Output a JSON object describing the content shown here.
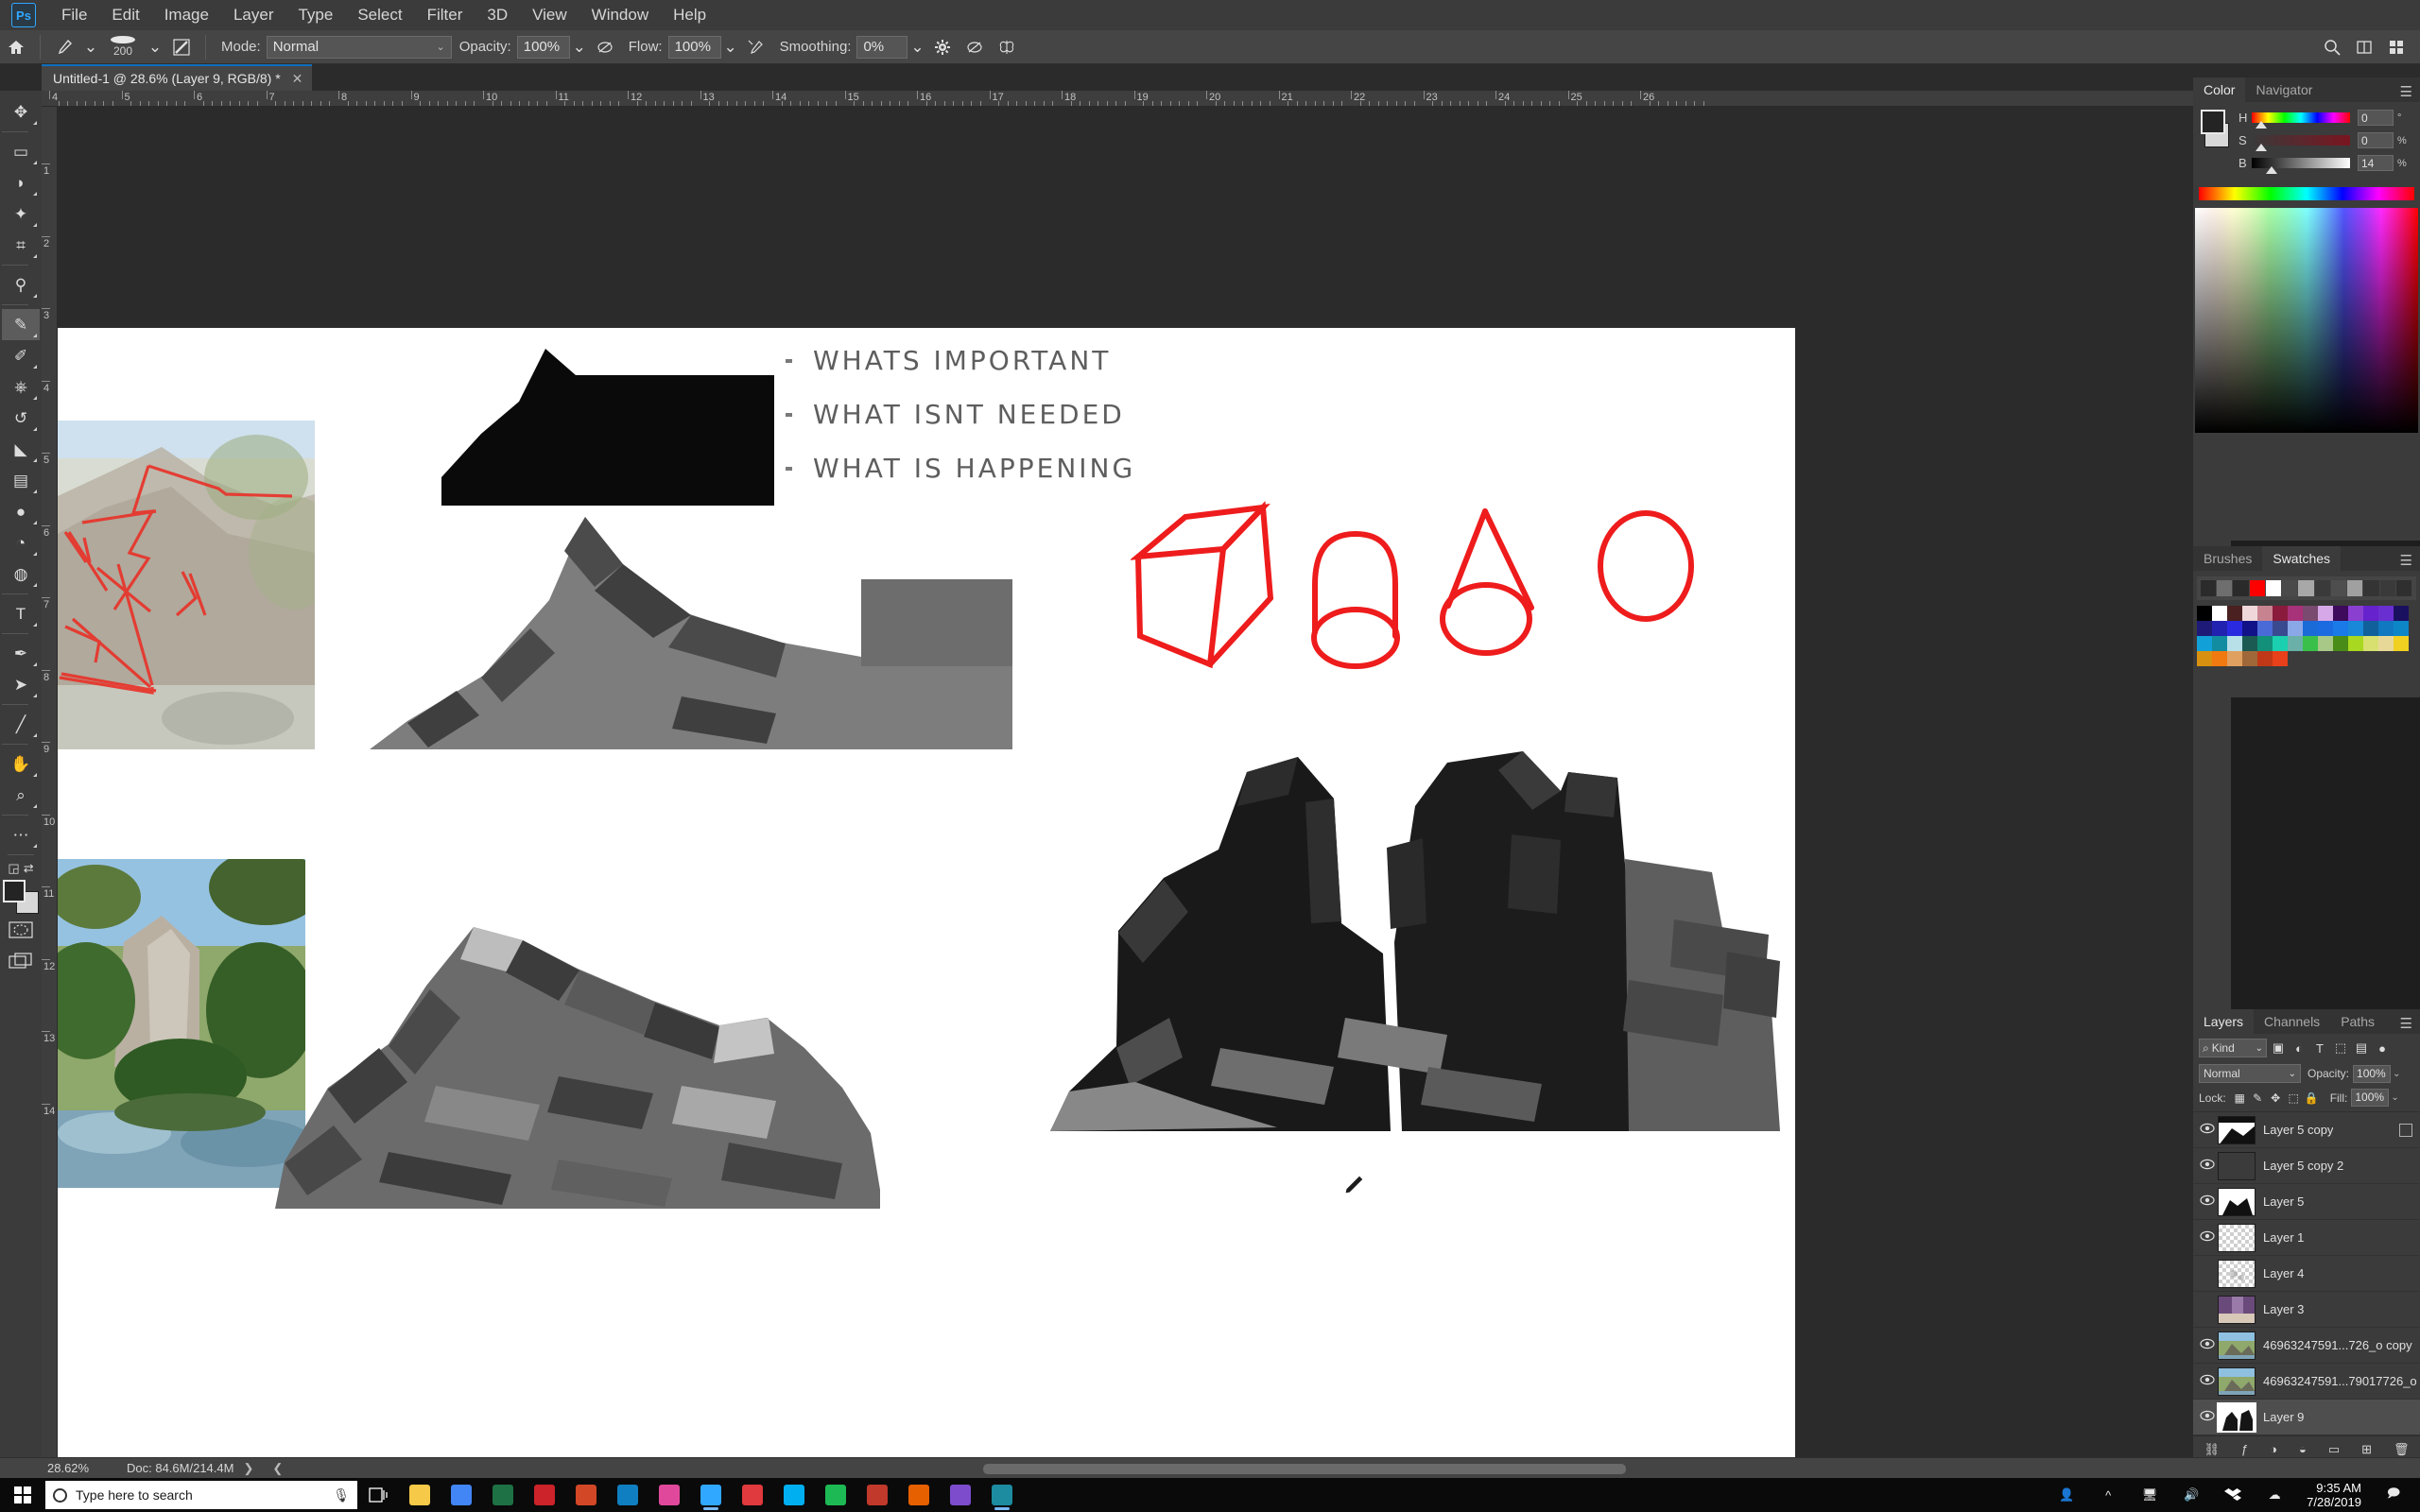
{
  "app": {
    "name": "Adobe Photoshop",
    "logo_text": "Ps"
  },
  "menubar": {
    "items": [
      "File",
      "Edit",
      "Image",
      "Layer",
      "Type",
      "Select",
      "Filter",
      "3D",
      "View",
      "Window",
      "Help"
    ]
  },
  "options_bar": {
    "home_icon": "home-icon",
    "tool_icon": "brush-tool-icon",
    "brush_size": "200",
    "brush_panel_icon": "brush-settings-icon",
    "mode_label": "Mode:",
    "mode_value": "Normal",
    "opacity_label": "Opacity:",
    "opacity_value": "100%",
    "pressure_opacity_icon": "pressure-opacity-icon",
    "flow_label": "Flow:",
    "flow_value": "100%",
    "airbrush_icon": "airbrush-icon",
    "smoothing_label": "Smoothing:",
    "smoothing_value": "0%",
    "smoothing_options_icon": "gear-icon",
    "angle_icon": "brush-angle-icon",
    "symmetry_icon": "symmetry-butterfly-icon",
    "tablet_pressure_icon": "tablet-pressure-icon",
    "search_icon": "search-icon",
    "arrange_icon": "arrange-documents-icon",
    "workspace_icon": "workspace-switcher-icon"
  },
  "document_tab": {
    "title": "Untitled-1 @ 28.6% (Layer 9, RGB/8) *",
    "close_icon": "close-icon"
  },
  "tools": [
    {
      "name": "move-tool",
      "glyph": "✥",
      "selected": false
    },
    {
      "name": "rectangular-marquee-tool",
      "glyph": "▭",
      "selected": false
    },
    {
      "name": "lasso-tool",
      "glyph": "◗",
      "selected": false
    },
    {
      "name": "magic-wand-tool",
      "glyph": "✦",
      "selected": false
    },
    {
      "name": "crop-tool",
      "glyph": "⌗",
      "selected": false
    },
    {
      "name": "eyedropper-tool",
      "glyph": "⚲",
      "selected": false
    },
    {
      "name": "brush-tool",
      "glyph": "✎",
      "selected": true
    },
    {
      "name": "pencil-tool",
      "glyph": "✐",
      "selected": false
    },
    {
      "name": "clone-stamp-tool",
      "glyph": "⎈",
      "selected": false
    },
    {
      "name": "history-brush-tool",
      "glyph": "↺",
      "selected": false
    },
    {
      "name": "eraser-tool",
      "glyph": "◣",
      "selected": false
    },
    {
      "name": "gradient-tool",
      "glyph": "▤",
      "selected": false
    },
    {
      "name": "blur-tool",
      "glyph": "●",
      "selected": false
    },
    {
      "name": "dodge-tool",
      "glyph": "◔",
      "selected": false
    },
    {
      "name": "sponge-tool",
      "glyph": "◍",
      "selected": false
    },
    {
      "name": "type-tool",
      "glyph": "T",
      "selected": false
    },
    {
      "name": "pen-tool",
      "glyph": "✒",
      "selected": false
    },
    {
      "name": "path-selection-tool",
      "glyph": "➤",
      "selected": false
    },
    {
      "name": "line-tool",
      "glyph": "╱",
      "selected": false
    },
    {
      "name": "hand-tool",
      "glyph": "✋",
      "selected": false
    },
    {
      "name": "zoom-tool",
      "glyph": "⌕",
      "selected": false
    },
    {
      "name": "edit-toolbar-button",
      "glyph": "⋯",
      "selected": false
    }
  ],
  "tool_extras": {
    "default_colors_icon": "default-colors-icon",
    "swap_colors_icon": "swap-colors-icon",
    "foreground_color": "#242424",
    "background_color": "#d8d8d8",
    "quickmask_icon": "quick-mask-icon",
    "screenmode_icon": "screen-mode-icon"
  },
  "rulers": {
    "horizontal_labels": [
      "4",
      "5",
      "6",
      "7",
      "8",
      "9",
      "10",
      "11",
      "12",
      "13",
      "14",
      "15",
      "16",
      "17",
      "18",
      "19",
      "20",
      "21",
      "22",
      "23",
      "24",
      "25",
      "26"
    ],
    "vertical_labels": [
      "1",
      "2",
      "3",
      "4",
      "5",
      "6",
      "7",
      "8",
      "9",
      "10",
      "11",
      "12",
      "13",
      "14"
    ]
  },
  "canvas": {
    "notes": [
      "WHATS IMPORTANT",
      "WHAT ISNT NEEDED",
      "WHAT IS HAPPENING"
    ],
    "primitive_sketches": [
      "cube",
      "cylinder",
      "cone",
      "sphere"
    ],
    "sketch_stroke_color": "#ee1c1c",
    "artwork_items": [
      "black-silhouette-mountain",
      "grey-mountain-study",
      "rock-cluster-dark",
      "rock-formation-grey",
      "reference-photo-cliff-top",
      "reference-photo-cliff-bottom"
    ],
    "cursor_icon": "brush-cursor-icon"
  },
  "vertical_dock": {
    "items": [
      {
        "name": "history-panel-icon",
        "glyph": "↺"
      },
      {
        "name": "3d-panel-icon",
        "glyph": "▣"
      },
      {
        "name": "info-panel-icon",
        "glyph": "ⓘ"
      },
      {
        "name": "clone-source-panel-icon",
        "glyph": "⎈"
      },
      {
        "name": "tool-presets-panel-icon",
        "glyph": "✂"
      },
      {
        "name": "creative-cloud-libraries-icon",
        "glyph": "◎"
      },
      {
        "name": "brush-presets-panel-icon",
        "glyph": "✐"
      }
    ]
  },
  "color_panel": {
    "tabs": [
      {
        "label": "Color",
        "active": true
      },
      {
        "label": "Navigator",
        "active": false
      }
    ],
    "menu_icon": "panel-menu-icon",
    "channels": [
      {
        "label": "H",
        "value": "0",
        "unit": "°",
        "thumb_pct": 4
      },
      {
        "label": "S",
        "value": "0",
        "unit": "%",
        "thumb_pct": 4
      },
      {
        "label": "B",
        "value": "14",
        "unit": "%",
        "thumb_pct": 14
      }
    ],
    "foreground_color": "#242424",
    "background_color": "#d8d8d8"
  },
  "swatches_panel": {
    "tabs": [
      {
        "label": "Brushes",
        "active": false
      },
      {
        "label": "Swatches",
        "active": true
      }
    ],
    "menu_icon": "panel-menu-icon",
    "recent_colors": [
      "#2b2b2b",
      "#6e6e6e",
      "#2a2a2a",
      "#ff0000",
      "#ffffff",
      "#4a4a4a",
      "#a8a8a8",
      "#3a3a3a",
      "#4e4e4e",
      "#a0a0a0",
      "#343434",
      "#3a3a3a",
      "#2f2f2f"
    ],
    "grid_colors": [
      "#000000",
      "#ffffff",
      "#4a2020",
      "#f0d8da",
      "#c78490",
      "#8a1b3c",
      "#a8327a",
      "#7a4a70",
      "#d7a8e8",
      "#3d0a5c",
      "#8a3fd0",
      "#6622cc",
      "#6a2fd0",
      "#1a1060",
      "#1d1a78",
      "#2222b0",
      "#2a2ae0",
      "#121288",
      "#4a6ad8",
      "#3a4a90",
      "#8aa8e8",
      "#1a6ad8",
      "#1a6ae0",
      "#1a7ae8",
      "#1a88d8",
      "#10609c",
      "#1078c0",
      "#0d86c8",
      "#12a0d8",
      "#128ca0",
      "#b8e0e8",
      "#1a5a52",
      "#12907a",
      "#1ad0b0",
      "#6ab0a8",
      "#3ac04a",
      "#a8c888",
      "#4a8c18",
      "#a8d820",
      "#d8e070",
      "#e8d898",
      "#f0d020",
      "#d89010",
      "#f07a10",
      "#e0a060",
      "#a06838",
      "#c03818",
      "#e8401a"
    ]
  },
  "layers_panel": {
    "tabs": [
      {
        "label": "Layers",
        "active": true
      },
      {
        "label": "Channels",
        "active": false
      },
      {
        "label": "Paths",
        "active": false
      }
    ],
    "menu_icon": "panel-menu-icon",
    "filter_kind_label": "Kind",
    "filter_icons": [
      "pixel-filter-icon",
      "adjustment-filter-icon",
      "type-filter-icon",
      "shape-filter-icon",
      "smartobject-filter-icon"
    ],
    "filter_toggle_icon": "filter-toggle-icon",
    "blend_mode": "Normal",
    "opacity_label": "Opacity:",
    "opacity_value": "100%",
    "lock_label": "Lock:",
    "lock_icons": [
      "lock-transparent-pixels-icon",
      "lock-image-pixels-icon",
      "lock-position-icon",
      "lock-artboard-icon",
      "lock-all-icon"
    ],
    "fill_label": "Fill:",
    "fill_value": "100%",
    "layers": [
      {
        "name": "Layer 5 copy",
        "visible": true,
        "selected": false,
        "thumb": "mask-black-white",
        "has_badge": true
      },
      {
        "name": "Layer 5 copy 2",
        "visible": true,
        "selected": false,
        "thumb": "mountain-grey",
        "has_badge": false
      },
      {
        "name": "Layer 5",
        "visible": true,
        "selected": false,
        "thumb": "rock-black",
        "has_badge": false
      },
      {
        "name": "Layer 1",
        "visible": true,
        "selected": false,
        "thumb": "empty-checker",
        "has_badge": false
      },
      {
        "name": "Layer 4",
        "visible": false,
        "selected": false,
        "thumb": "faint-checker",
        "has_badge": false
      },
      {
        "name": "Layer 3",
        "visible": false,
        "selected": false,
        "thumb": "purple-photo",
        "has_badge": false
      },
      {
        "name": "46963247591...726_o copy",
        "visible": true,
        "selected": false,
        "thumb": "landscape-photo",
        "has_badge": false
      },
      {
        "name": "46963247591...79017726_o",
        "visible": true,
        "selected": false,
        "thumb": "landscape-photo",
        "has_badge": false
      },
      {
        "name": "Layer 9",
        "visible": true,
        "selected": true,
        "thumb": "rock-cluster",
        "has_badge": false
      }
    ],
    "footer_icons": [
      "link-layers-icon",
      "layer-style-icon",
      "layer-mask-icon",
      "adjustment-layer-icon",
      "new-group-icon",
      "new-layer-icon",
      "delete-layer-icon"
    ]
  },
  "status_bar": {
    "zoom": "28.62%",
    "doc_info": "Doc: 84.6M/214.4M",
    "expand_icon": "expand-arrow-icon"
  },
  "taskbar": {
    "start_icon": "windows-start-icon",
    "search_icon": "search-circle-icon",
    "search_placeholder": "Type here to search",
    "mic_icon": "microphone-icon",
    "task_view_icon": "task-view-icon",
    "apps": [
      {
        "name": "file-explorer-icon",
        "color": "#f7c948",
        "running": false
      },
      {
        "name": "chrome-icon",
        "color": "#4285f4",
        "running": false
      },
      {
        "name": "excel-icon",
        "color": "#1e7145",
        "running": false
      },
      {
        "name": "adobe-reader-icon",
        "color": "#cc2229",
        "running": false
      },
      {
        "name": "powerpoint-icon",
        "color": "#d24726",
        "running": false
      },
      {
        "name": "edge-icon",
        "color": "#0f7fc1",
        "running": false
      },
      {
        "name": "app-pink-icon",
        "color": "#e0499b",
        "running": false
      },
      {
        "name": "photoshop-icon",
        "color": "#31a8ff",
        "running": true
      },
      {
        "name": "opera-icon",
        "color": "#e0393e",
        "running": false
      },
      {
        "name": "skype-icon",
        "color": "#00aff0",
        "running": false
      },
      {
        "name": "spotify-icon",
        "color": "#1db954",
        "running": false
      },
      {
        "name": "app-red-icon",
        "color": "#c0392b",
        "running": false
      },
      {
        "name": "firefox-icon",
        "color": "#e66000",
        "running": false
      },
      {
        "name": "app-purple-icon",
        "color": "#7d4ccc",
        "running": false
      },
      {
        "name": "app-teal-icon",
        "color": "#1d8ba0",
        "running": true
      }
    ],
    "tray_icons": [
      "people-icon",
      "show-hidden-icons-icon",
      "network-icon",
      "volume-icon",
      "dropbox-icon",
      "onedrive-icon"
    ],
    "clock_time": "9:35 AM",
    "clock_date": "7/28/2019",
    "action_center_icon": "action-center-icon"
  }
}
